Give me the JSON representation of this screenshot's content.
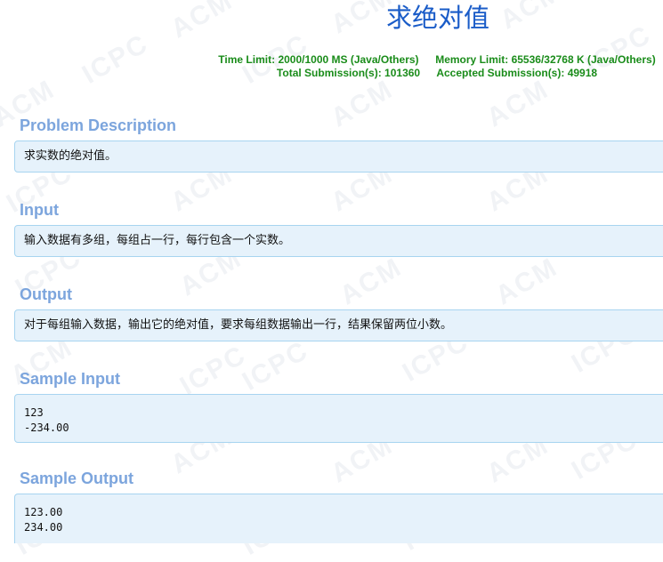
{
  "problem": {
    "title": "求绝对值",
    "time_limit_label": "Time Limit:",
    "time_limit": "2000/1000 MS (Java/Others)",
    "memory_limit_label": "Memory Limit:",
    "memory_limit": "65536/32768 K (Java/Others)",
    "total_label": "Total Submission(s):",
    "total": "101360",
    "accepted_label": "Accepted Submission(s):",
    "accepted": "49918"
  },
  "sections": {
    "description": {
      "heading": "Problem Description",
      "text": "求实数的绝对值。"
    },
    "input": {
      "heading": "Input",
      "text": "输入数据有多组，每组占一行，每行包含一个实数。"
    },
    "output": {
      "heading": "Output",
      "text": "对于每组输入数据，输出它的绝对值，要求每组数据输出一行，结果保留两位小数。"
    },
    "sample_input": {
      "heading": "Sample Input",
      "lines": [
        "123",
        "-234.00"
      ]
    },
    "sample_output": {
      "heading": "Sample Output",
      "lines": [
        "123.00",
        "234.00"
      ]
    }
  },
  "theme": {
    "title_color": "#1a5cc8",
    "stats_color": "#1a8c1a",
    "heading_color": "#7ca5dd",
    "panel_bg": "#e6f2fb",
    "panel_border": "#a7d4f0"
  }
}
